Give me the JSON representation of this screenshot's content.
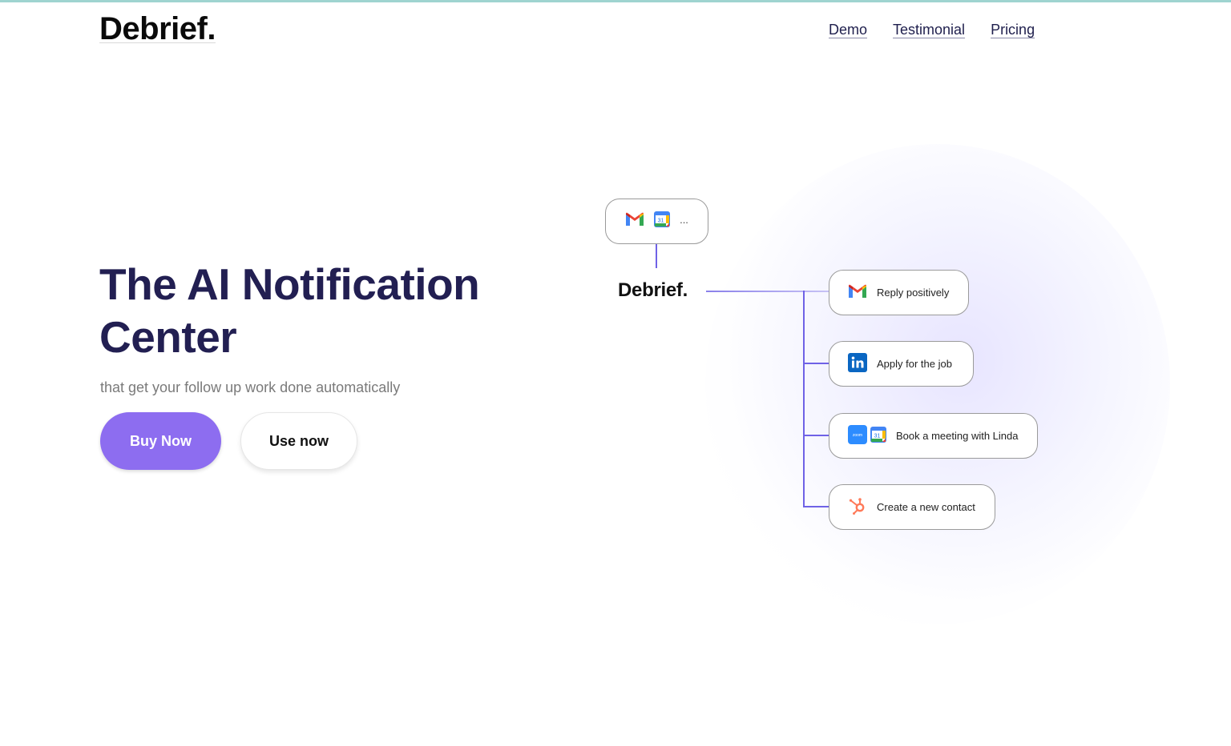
{
  "header": {
    "logo": "Debrief.",
    "nav": [
      "Demo",
      "Testimonial",
      "Pricing"
    ]
  },
  "hero": {
    "title": "The AI Notification Center",
    "subtitle": "that get your follow up work done automatically",
    "buy_label": "Buy Now",
    "use_label": "Use now"
  },
  "diagram": {
    "source_more": "...",
    "center_logo": "Debrief.",
    "actions": [
      {
        "label": "Reply positively",
        "icons": [
          "gmail-icon"
        ]
      },
      {
        "label": "Apply for the job",
        "icons": [
          "linkedin-icon"
        ]
      },
      {
        "label": "Book a meeting with Linda",
        "icons": [
          "zoom-icon",
          "google-calendar-icon"
        ]
      },
      {
        "label": "Create a new contact",
        "icons": [
          "hubspot-icon"
        ]
      }
    ],
    "zoom_text": "zoom",
    "calendar_day": "31"
  },
  "colors": {
    "title": "#221f52",
    "buy_button": "#8d6df0",
    "connector": "#6f62e6"
  }
}
